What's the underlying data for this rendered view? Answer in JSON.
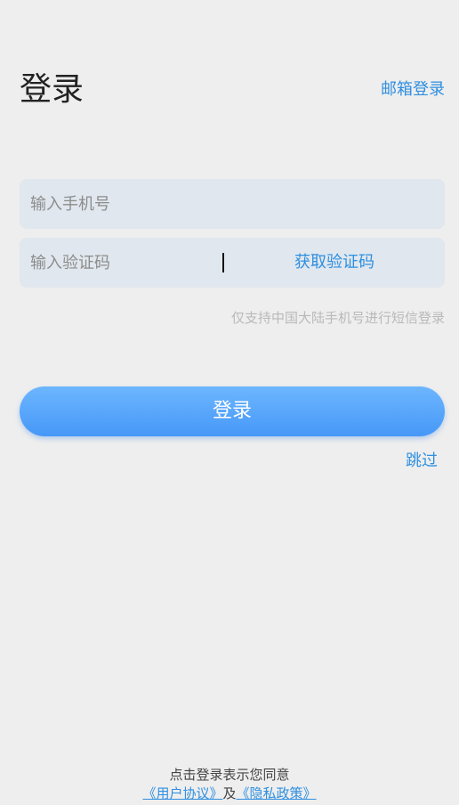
{
  "header": {
    "title": "登录",
    "email_login_label": "邮箱登录"
  },
  "form": {
    "phone_placeholder": "输入手机号",
    "phone_value": "",
    "code_placeholder": "输入验证码",
    "code_value": "",
    "get_code_label": "获取验证码",
    "hint": "仅支持中国大陆手机号进行短信登录"
  },
  "actions": {
    "login_label": "登录",
    "skip_label": "跳过"
  },
  "agreement": {
    "prefix": "点击登录表示您同意",
    "user_agreement": "《用户协议》",
    "and_text": "及",
    "privacy_policy": "《隐私政策》"
  },
  "colors": {
    "accent": "#2f8fe0",
    "button_top": "#6db6ff",
    "button_bottom": "#4698f7",
    "field_background": "#e0e7ee",
    "page_background": "#eeeeee"
  }
}
